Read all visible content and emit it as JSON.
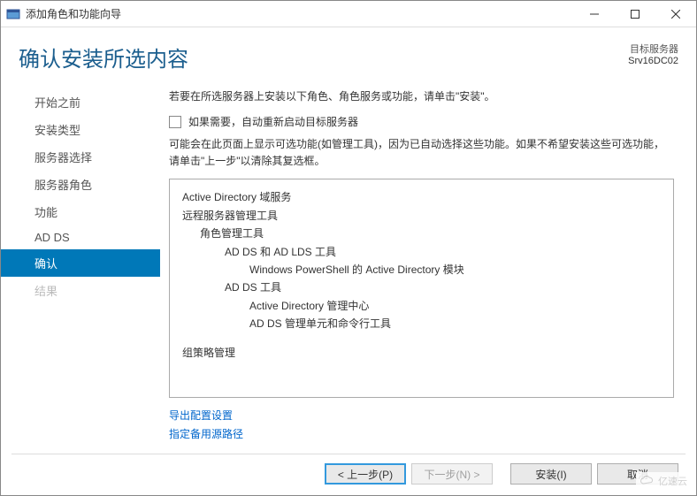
{
  "window": {
    "title": "添加角色和功能向导"
  },
  "header": {
    "page_title": "确认安装所选内容",
    "target_label": "目标服务器",
    "target_value": "Srv16DC02"
  },
  "sidebar": {
    "items": [
      {
        "label": "开始之前",
        "state": "normal"
      },
      {
        "label": "安装类型",
        "state": "normal"
      },
      {
        "label": "服务器选择",
        "state": "normal"
      },
      {
        "label": "服务器角色",
        "state": "normal"
      },
      {
        "label": "功能",
        "state": "normal"
      },
      {
        "label": "AD DS",
        "state": "normal"
      },
      {
        "label": "确认",
        "state": "active"
      },
      {
        "label": "结果",
        "state": "disabled"
      }
    ]
  },
  "content": {
    "instruction": "若要在所选服务器上安装以下角色、角色服务或功能，请单击\"安装\"。",
    "checkbox_label": "如果需要，自动重新启动目标服务器",
    "note": "可能会在此页面上显示可选功能(如管理工具)，因为已自动选择这些功能。如果不希望安装这些可选功能，请单击\"上一步\"以清除其复选框。",
    "features": [
      {
        "indent": 0,
        "text": "Active Directory 域服务"
      },
      {
        "indent": 0,
        "text": "远程服务器管理工具"
      },
      {
        "indent": 1,
        "text": "角色管理工具"
      },
      {
        "indent": 2,
        "text": "AD DS 和 AD LDS 工具"
      },
      {
        "indent": 3,
        "text": "Windows PowerShell 的 Active Directory 模块"
      },
      {
        "indent": 2,
        "text": "AD DS 工具"
      },
      {
        "indent": 3,
        "text": "Active Directory 管理中心"
      },
      {
        "indent": 3,
        "text": "AD DS 管理单元和命令行工具"
      },
      {
        "indent": 0,
        "text": "组策略管理"
      }
    ],
    "links": {
      "export": "导出配置设置",
      "alt_source": "指定备用源路径"
    }
  },
  "buttons": {
    "prev": "< 上一步(P)",
    "next": "下一步(N) >",
    "install": "安装(I)",
    "cancel": "取消"
  },
  "brand": "亿速云"
}
